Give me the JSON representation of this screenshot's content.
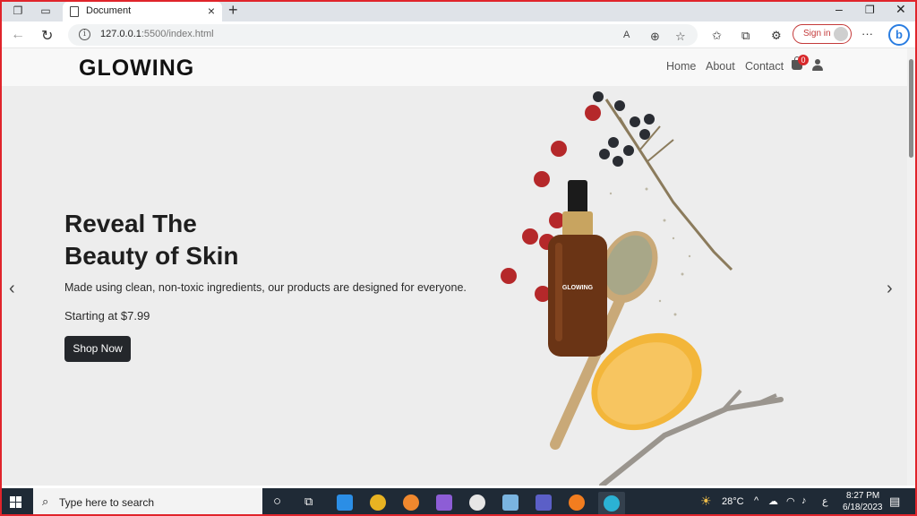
{
  "browser": {
    "tab_title": "Document",
    "url_host": "127.0.0.1",
    "url_path": ":5500/index.html",
    "sign_in_label": "Sign in"
  },
  "site": {
    "logo": "GLOWING",
    "nav": {
      "home": "Home",
      "about": "About",
      "contact": "Contact"
    },
    "cart_count": "0",
    "hero": {
      "title_line1": "Reveal The",
      "title_line2": "Beauty of Skin",
      "description": "Made using clean, non-toxic ingredients, our products are designed for everyone.",
      "price": "Starting at $7.99",
      "button": "Shop Now",
      "bottle_label": "GLOWING"
    },
    "prev_arrow": "‹",
    "next_arrow": "›"
  },
  "taskbar": {
    "search_placeholder": "Type here to search",
    "temperature": "28°C",
    "lang": "ع",
    "time": "8:27 PM",
    "date": "6/18/2023"
  },
  "colors": {
    "accent_red": "#d8282b",
    "button_dark": "#24272b",
    "hero_bg": "#ededed",
    "taskbar_bg": "#1f2a36"
  }
}
